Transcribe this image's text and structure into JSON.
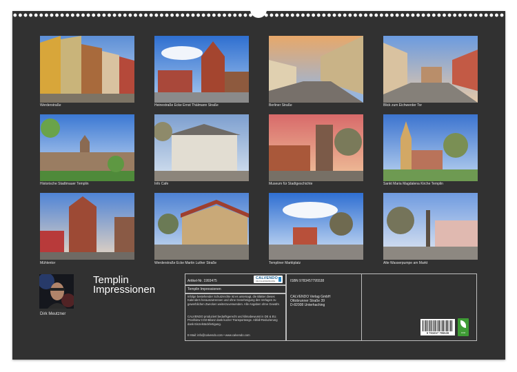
{
  "calendar": {
    "title_line1": "Templin",
    "title_line2": "Impressionen",
    "author": "Dirk Meutzner"
  },
  "captions": [
    "Werderstraße",
    "Heinestraße Ecke Ernst Thälmann Straße",
    "Berliner Straße",
    "Blick zum Eichwerder Tor",
    "Historische Stadtmauer Templin",
    "Info Cafe",
    "Museum für Stadtgeschichte",
    "Sankt Maria Magdalena Kirche Templin",
    "Mühlentor",
    "Werderstraße Ecke Martin Luther Straße",
    "Templiner Marktplatz",
    "Alte Wasserpumpe am Markt"
  ],
  "info": {
    "article_no": "Artikel-Nr. 1993475",
    "product_title": "Templin Impressionen",
    "legal_text": "Infolge bestehender Schutzrechte ist es untersagt, die Blätter dieses Kalenders herauszutrennen und ohne Genehmigung des Verlages zu gewerblichen Zwecken weiterzuverwenden. Alle Angaben ohne Gewähr.",
    "production_text": "CALVENDO produziert bedarfsgerecht und klimabewusst in DE & EU. Proofview CO2-Bilanz dank kurzer Transportwege. Abfall-Reduzierung dank Einzelstückfertigung.",
    "contact": "E-Mail: info@calvendo.com • www.calvendo.com",
    "isbn": "ISBN 9783457795538",
    "publisher_name": "CALVENDO Verlag GmbH",
    "publisher_street": "Ottobrunner Straße 39",
    "publisher_city": "D-82008 Unterhaching",
    "barcode_number": "9 783457 795538",
    "logo_word": "CALVENDO",
    "logo_sub": "DIE KALENDERMARKE",
    "eco_label": "CO2"
  },
  "colors": {
    "page": "#313131",
    "text": "#e6e6e6",
    "logo_blue": "#1a5e8f",
    "eco_green": "#3f9b35"
  }
}
